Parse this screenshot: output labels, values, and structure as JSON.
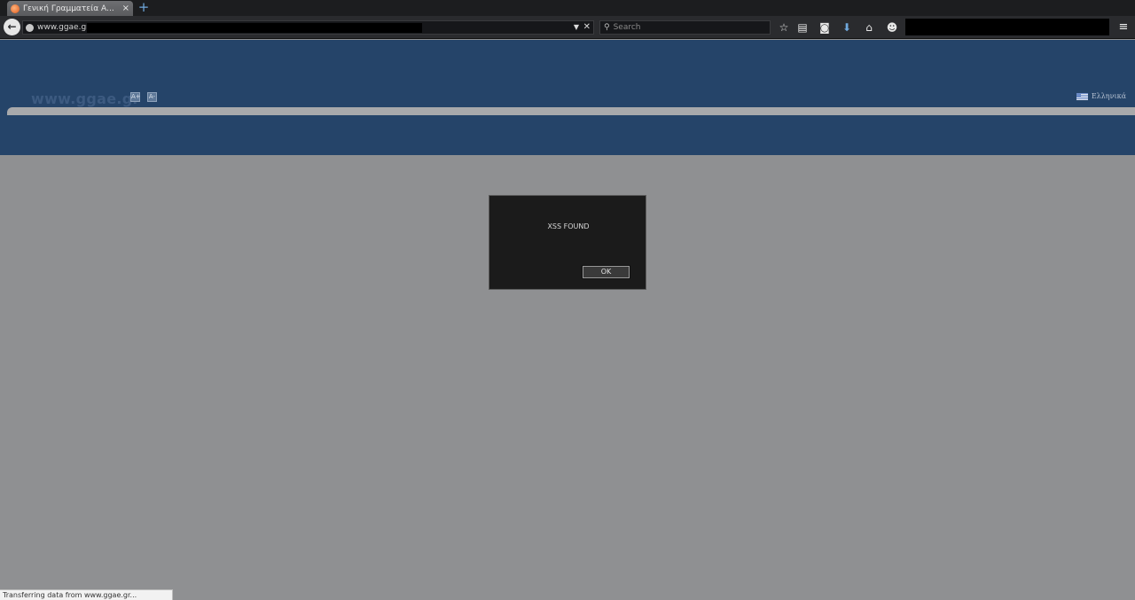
{
  "browser": {
    "tab": {
      "title": "Γενική Γραμματεία Α...",
      "close": "×"
    },
    "new_tab": "+",
    "back": "←",
    "url": "www.ggae.gr/",
    "url_dropdown": "▼",
    "url_clear": "✕",
    "search": {
      "placeholder": "Search",
      "icon": "search-icon"
    },
    "toolbar_icons": [
      {
        "name": "bookmark-star-icon",
        "glyph": "☆"
      },
      {
        "name": "reading-list-icon",
        "glyph": "▤"
      },
      {
        "name": "pocket-icon",
        "glyph": "◙"
      },
      {
        "name": "download-icon",
        "glyph": "⬇"
      },
      {
        "name": "home-icon",
        "glyph": "⌂"
      },
      {
        "name": "chat-icon",
        "glyph": "☻"
      }
    ],
    "menu": "≡"
  },
  "site": {
    "logo": "www.ggae.gr",
    "font_increase": "A+",
    "font_decrease": "A-",
    "language": "Ελληνικά"
  },
  "dialog": {
    "message": "XSS FOUND",
    "ok_label": "OK"
  },
  "status": "Transferring data from www.ggae.gr...",
  "colors": {
    "header": "#254469",
    "page_background": "#8f9092",
    "dialog_background": "#1b1b1b"
  }
}
